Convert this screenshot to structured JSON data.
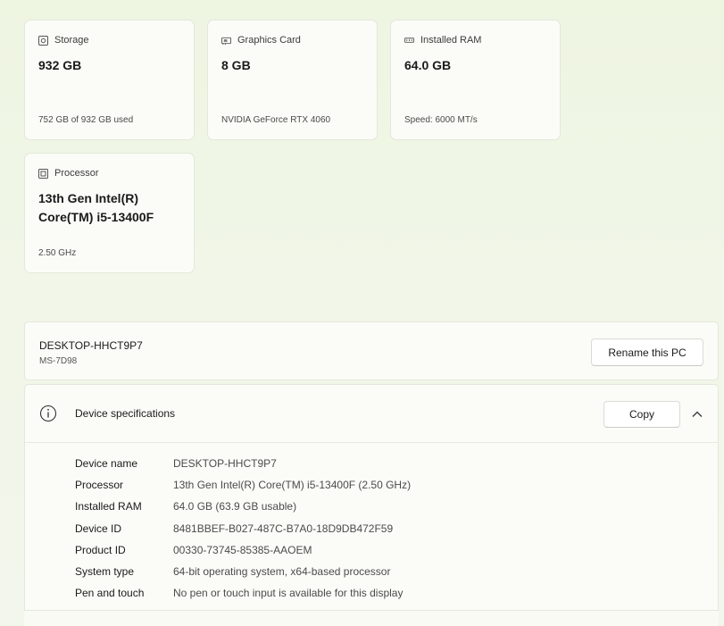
{
  "cards": [
    {
      "icon": "storage-icon",
      "title": "Storage",
      "value": "932 GB",
      "sub": "752 GB of 932 GB used"
    },
    {
      "icon": "graphics-card-icon",
      "title": "Graphics Card",
      "value": "8 GB",
      "sub": "NVIDIA GeForce RTX 4060"
    },
    {
      "icon": "ram-icon",
      "title": "Installed RAM",
      "value": "64.0 GB",
      "sub": "Speed: 6000 MT/s"
    },
    {
      "icon": "processor-icon",
      "title": "Processor",
      "value": "13th Gen Intel(R) Core(TM) i5-13400F",
      "sub": "2.50 GHz"
    }
  ],
  "pc": {
    "name": "DESKTOP-HHCT9P7",
    "model": "MS-7D98",
    "rename_label": "Rename this PC"
  },
  "specs": {
    "title": "Device specifications",
    "copy_label": "Copy",
    "rows": [
      {
        "label": "Device name",
        "value": "DESKTOP-HHCT9P7"
      },
      {
        "label": "Processor",
        "value": "13th Gen Intel(R) Core(TM) i5-13400F (2.50 GHz)"
      },
      {
        "label": "Installed RAM",
        "value": "64.0 GB (63.9 GB usable)"
      },
      {
        "label": "Device ID",
        "value": "8481BBEF-B027-487C-B7A0-18D9DB472F59"
      },
      {
        "label": "Product ID",
        "value": "00330-73745-85385-AAOEM"
      },
      {
        "label": "System type",
        "value": "64-bit operating system, x64-based processor"
      },
      {
        "label": "Pen and touch",
        "value": "No pen or touch input is available for this display"
      }
    ]
  }
}
